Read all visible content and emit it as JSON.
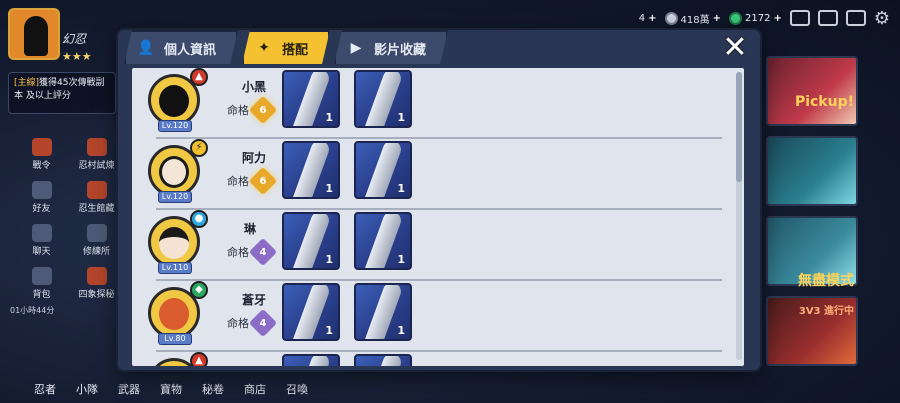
{
  "hud": {
    "player_name": "幻忍",
    "stars": "★★★",
    "quest_tag": "[主線]",
    "quest_text": "獲得45次傳戰副本 及以上評分",
    "resources": [
      {
        "icon": "ticket-icon",
        "value": "4"
      },
      {
        "icon": "silver-coin-icon",
        "value": "418萬"
      },
      {
        "icon": "jade-icon",
        "value": "2172"
      }
    ],
    "side_items": [
      "戰令",
      "忍村試煉",
      "好友",
      "忍生館藏",
      "聊天",
      "修練所",
      "背包",
      "四象探秘"
    ],
    "clock": "01小時44分",
    "bottom_nav": [
      "忍者",
      "小隊",
      "武器",
      "寶物",
      "秘卷",
      "商店",
      "召喚"
    ],
    "right_banners": [
      "Pickup!",
      "",
      "無盡模式",
      "3V3 進行中"
    ]
  },
  "modal": {
    "tabs": [
      {
        "label": "個人資訊",
        "icon": "profile-icon",
        "active": false
      },
      {
        "label": "搭配",
        "icon": "shuriken-icon",
        "active": true
      },
      {
        "label": "影片收藏",
        "icon": "play-icon",
        "active": false
      }
    ],
    "close_symbol": "✕",
    "fate_label": "命格",
    "rows": [
      {
        "name": "小黑",
        "level": "Lv.120",
        "element": "fire",
        "fate_rank": "6",
        "fate_color": "gold",
        "slots": [
          "1",
          "1"
        ]
      },
      {
        "name": "阿力",
        "level": "Lv.120",
        "element": "bolt",
        "fate_rank": "6",
        "fate_color": "gold",
        "slots": [
          "1",
          "1"
        ]
      },
      {
        "name": "琳",
        "level": "Lv.110",
        "element": "water",
        "fate_rank": "4",
        "fate_color": "purple",
        "slots": [
          "1",
          "1"
        ]
      },
      {
        "name": "蒼牙",
        "level": "Lv.80",
        "element": "wind",
        "fate_rank": "4",
        "fate_color": "purple",
        "slots": [
          "1",
          "1"
        ]
      },
      {
        "name": "",
        "level": "",
        "element": "fire",
        "fate_rank": "",
        "fate_color": "",
        "slots": [
          "",
          ""
        ]
      }
    ]
  }
}
